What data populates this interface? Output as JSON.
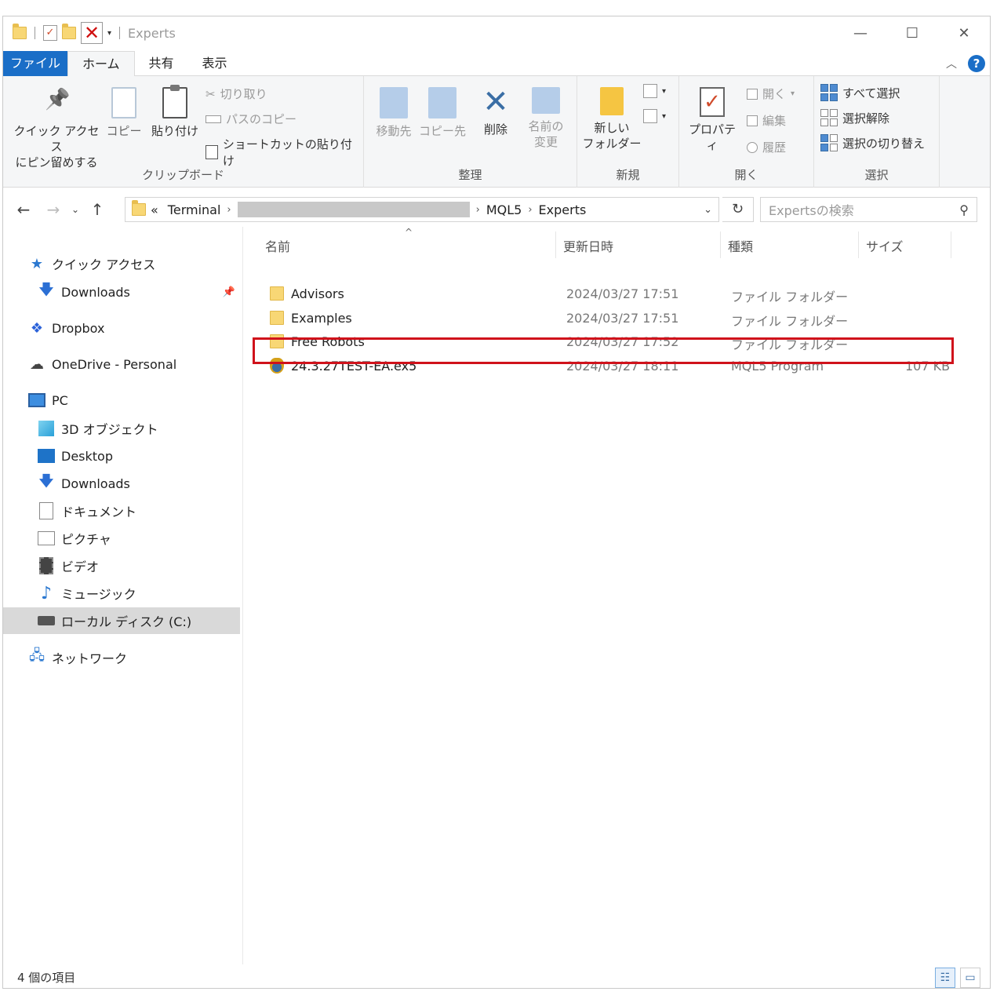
{
  "window": {
    "title": "Experts"
  },
  "tabs": [
    {
      "label": "ファイル"
    },
    {
      "label": "ホーム"
    },
    {
      "label": "共有"
    },
    {
      "label": "表示"
    }
  ],
  "ribbon": {
    "clipboard": {
      "pin_label_1": "クイック アクセス",
      "pin_label_2": "にピン留めする",
      "copy_label": "コピー",
      "paste_label": "貼り付け",
      "cut_label": "切り取り",
      "copy_path_label": "パスのコピー",
      "paste_shortcut_label": "ショートカットの貼り付け",
      "group_label": "クリップボード"
    },
    "organize": {
      "move_label": "移動先",
      "copyto_label": "コピー先",
      "delete_label": "削除",
      "rename_label_1": "名前の",
      "rename_label_2": "変更",
      "group_label": "整理"
    },
    "new": {
      "newfolder_label_1": "新しい",
      "newfolder_label_2": "フォルダー",
      "group_label": "新規"
    },
    "open": {
      "properties_label": "プロパティ",
      "open_label": "開く",
      "edit_label": "編集",
      "history_label": "履歴",
      "group_label": "開く"
    },
    "select": {
      "select_all_label": "すべて選択",
      "select_none_label": "選択解除",
      "invert_label": "選択の切り替え",
      "group_label": "選択"
    }
  },
  "address": {
    "overflow": "«",
    "crumb_1": "Terminal",
    "crumb_3": "MQL5",
    "crumb_4": "Experts",
    "search_placeholder": "Expertsの検索"
  },
  "navpane": {
    "items": [
      {
        "label": "クイック アクセス"
      },
      {
        "label": "Downloads"
      },
      {
        "label": "Dropbox"
      },
      {
        "label": "OneDrive - Personal"
      },
      {
        "label": "PC"
      },
      {
        "label": "3D オブジェクト"
      },
      {
        "label": "Desktop"
      },
      {
        "label": "Downloads"
      },
      {
        "label": "ドキュメント"
      },
      {
        "label": "ピクチャ"
      },
      {
        "label": "ビデオ"
      },
      {
        "label": "ミュージック"
      },
      {
        "label": "ローカル ディスク (C:)"
      },
      {
        "label": "ネットワーク"
      }
    ]
  },
  "list": {
    "columns": {
      "name": "名前",
      "date": "更新日時",
      "type": "種類",
      "size": "サイズ"
    },
    "rows": [
      {
        "name": "Advisors",
        "date": "2024/03/27 17:51",
        "type": "ファイル フォルダー",
        "size": ""
      },
      {
        "name": "Examples",
        "date": "2024/03/27 17:51",
        "type": "ファイル フォルダー",
        "size": ""
      },
      {
        "name": "Free Robots",
        "date": "2024/03/27 17:52",
        "type": "ファイル フォルダー",
        "size": ""
      },
      {
        "name": "24.3.27TEST-EA.ex5",
        "date": "2024/03/27 18:11",
        "type": "MQL5 Program",
        "size": "107 KB"
      }
    ]
  },
  "status": {
    "count": "4 個の項目"
  },
  "colors": {
    "accent": "#1a6ec7",
    "highlight": "#d0121b"
  }
}
